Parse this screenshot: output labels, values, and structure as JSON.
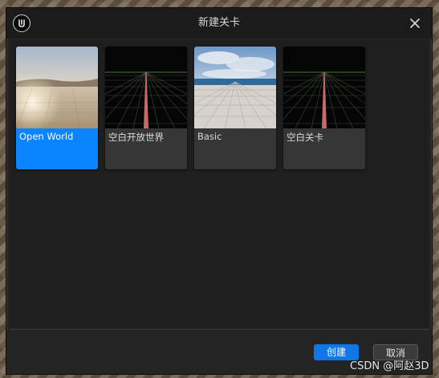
{
  "dialog": {
    "title": "新建关卡"
  },
  "templates": [
    {
      "label": "Open World",
      "selected": true,
      "thumbnail": "desert-sky-scene"
    },
    {
      "label": "空白开放世界",
      "selected": false,
      "thumbnail": "grid-horizon-scene"
    },
    {
      "label": "Basic",
      "selected": false,
      "thumbnail": "tiled-floor-sky-scene"
    },
    {
      "label": "空白关卡",
      "selected": false,
      "thumbnail": "grid-horizon-scene"
    }
  ],
  "footer": {
    "create_label": "创建",
    "cancel_label": "取消"
  },
  "watermark": "CSDN @阿赵3D",
  "colors": {
    "selection": "#0a84ff",
    "create_button": "#0f77e8",
    "dialog_bg": "#242424"
  },
  "icons": [
    "unreal-logo-icon",
    "close-icon"
  ]
}
